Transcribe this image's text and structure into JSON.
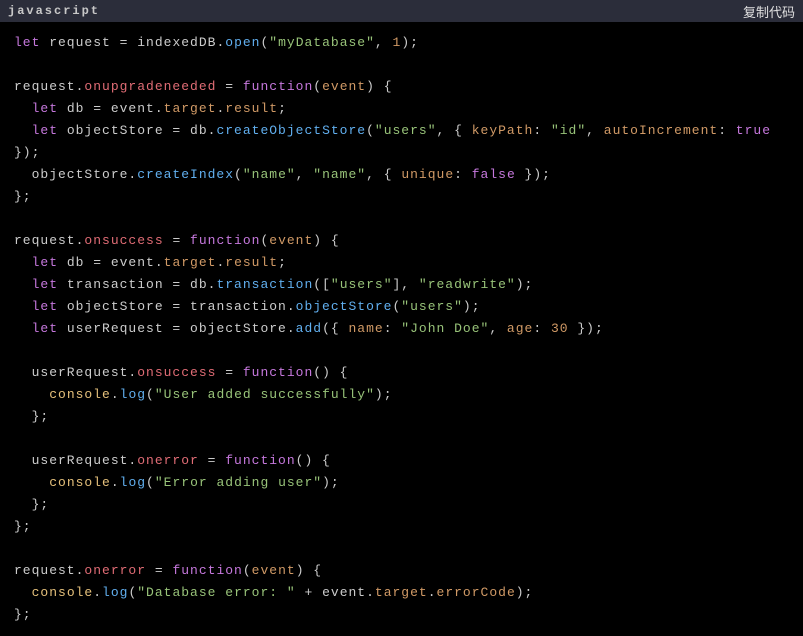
{
  "header": {
    "language": "javascript",
    "copy_label": "复制代码"
  },
  "code": {
    "tokens": [
      [
        [
          "kw",
          "let"
        ],
        [
          "punc",
          " request "
        ],
        [
          "punc",
          "="
        ],
        [
          "punc",
          " indexedDB"
        ],
        [
          "punc",
          "."
        ],
        [
          "method",
          "open"
        ],
        [
          "punc",
          "("
        ],
        [
          "str",
          "\"myDatabase\""
        ],
        [
          "punc",
          ", "
        ],
        [
          "num",
          "1"
        ],
        [
          "punc",
          ");"
        ]
      ],
      [],
      [
        [
          "punc",
          "request."
        ],
        [
          "prop",
          "onupgradeneeded"
        ],
        [
          "punc",
          " = "
        ],
        [
          "kw",
          "function"
        ],
        [
          "punc",
          "("
        ],
        [
          "prop2",
          "event"
        ],
        [
          "punc",
          ") {"
        ]
      ],
      [
        [
          "punc",
          "  "
        ],
        [
          "kw",
          "let"
        ],
        [
          "punc",
          " db = event."
        ],
        [
          "prop2",
          "target"
        ],
        [
          "punc",
          "."
        ],
        [
          "prop2",
          "result"
        ],
        [
          "punc",
          ";"
        ]
      ],
      [
        [
          "punc",
          "  "
        ],
        [
          "kw",
          "let"
        ],
        [
          "punc",
          " objectStore = db."
        ],
        [
          "method",
          "createObjectStore"
        ],
        [
          "punc",
          "("
        ],
        [
          "str",
          "\"users\""
        ],
        [
          "punc",
          ", { "
        ],
        [
          "objkey",
          "keyPath"
        ],
        [
          "punc",
          ": "
        ],
        [
          "str",
          "\"id\""
        ],
        [
          "punc",
          ", "
        ],
        [
          "objkey",
          "autoIncrement"
        ],
        [
          "punc",
          ": "
        ],
        [
          "kw",
          "true"
        ]
      ],
      [
        [
          "punc",
          "});"
        ]
      ],
      [
        [
          "punc",
          "  objectStore."
        ],
        [
          "method",
          "createIndex"
        ],
        [
          "punc",
          "("
        ],
        [
          "str",
          "\"name\""
        ],
        [
          "punc",
          ", "
        ],
        [
          "str",
          "\"name\""
        ],
        [
          "punc",
          ", { "
        ],
        [
          "objkey",
          "unique"
        ],
        [
          "punc",
          ": "
        ],
        [
          "kw",
          "false"
        ],
        [
          "punc",
          " });"
        ]
      ],
      [
        [
          "punc",
          "};"
        ]
      ],
      [],
      [
        [
          "punc",
          "request."
        ],
        [
          "prop",
          "onsuccess"
        ],
        [
          "punc",
          " = "
        ],
        [
          "kw",
          "function"
        ],
        [
          "punc",
          "("
        ],
        [
          "prop2",
          "event"
        ],
        [
          "punc",
          ") {"
        ]
      ],
      [
        [
          "punc",
          "  "
        ],
        [
          "kw",
          "let"
        ],
        [
          "punc",
          " db = event."
        ],
        [
          "prop2",
          "target"
        ],
        [
          "punc",
          "."
        ],
        [
          "prop2",
          "result"
        ],
        [
          "punc",
          ";"
        ]
      ],
      [
        [
          "punc",
          "  "
        ],
        [
          "kw",
          "let"
        ],
        [
          "punc",
          " transaction = db."
        ],
        [
          "method",
          "transaction"
        ],
        [
          "punc",
          "(["
        ],
        [
          "str",
          "\"users\""
        ],
        [
          "punc",
          "], "
        ],
        [
          "str",
          "\"readwrite\""
        ],
        [
          "punc",
          ");"
        ]
      ],
      [
        [
          "punc",
          "  "
        ],
        [
          "kw",
          "let"
        ],
        [
          "punc",
          " objectStore = transaction."
        ],
        [
          "method",
          "objectStore"
        ],
        [
          "punc",
          "("
        ],
        [
          "str",
          "\"users\""
        ],
        [
          "punc",
          ");"
        ]
      ],
      [
        [
          "punc",
          "  "
        ],
        [
          "kw",
          "let"
        ],
        [
          "punc",
          " userRequest = objectStore."
        ],
        [
          "method",
          "add"
        ],
        [
          "punc",
          "({ "
        ],
        [
          "objkey",
          "name"
        ],
        [
          "punc",
          ": "
        ],
        [
          "str",
          "\"John Doe\""
        ],
        [
          "punc",
          ", "
        ],
        [
          "objkey",
          "age"
        ],
        [
          "punc",
          ": "
        ],
        [
          "num",
          "30"
        ],
        [
          "punc",
          " });"
        ]
      ],
      [],
      [
        [
          "punc",
          "  userRequest."
        ],
        [
          "prop",
          "onsuccess"
        ],
        [
          "punc",
          " = "
        ],
        [
          "kw",
          "function"
        ],
        [
          "punc",
          "() {"
        ]
      ],
      [
        [
          "punc",
          "    "
        ],
        [
          "obj",
          "console"
        ],
        [
          "punc",
          "."
        ],
        [
          "method",
          "log"
        ],
        [
          "punc",
          "("
        ],
        [
          "str",
          "\"User added successfully\""
        ],
        [
          "punc",
          ");"
        ]
      ],
      [
        [
          "punc",
          "  };"
        ]
      ],
      [],
      [
        [
          "punc",
          "  userRequest."
        ],
        [
          "prop",
          "onerror"
        ],
        [
          "punc",
          " = "
        ],
        [
          "kw",
          "function"
        ],
        [
          "punc",
          "() {"
        ]
      ],
      [
        [
          "punc",
          "    "
        ],
        [
          "obj",
          "console"
        ],
        [
          "punc",
          "."
        ],
        [
          "method",
          "log"
        ],
        [
          "punc",
          "("
        ],
        [
          "str",
          "\"Error adding user\""
        ],
        [
          "punc",
          ");"
        ]
      ],
      [
        [
          "punc",
          "  };"
        ]
      ],
      [
        [
          "punc",
          "};"
        ]
      ],
      [],
      [
        [
          "punc",
          "request."
        ],
        [
          "prop",
          "onerror"
        ],
        [
          "punc",
          " = "
        ],
        [
          "kw",
          "function"
        ],
        [
          "punc",
          "("
        ],
        [
          "prop2",
          "event"
        ],
        [
          "punc",
          ") {"
        ]
      ],
      [
        [
          "punc",
          "  "
        ],
        [
          "obj",
          "console"
        ],
        [
          "punc",
          "."
        ],
        [
          "method",
          "log"
        ],
        [
          "punc",
          "("
        ],
        [
          "str",
          "\"Database error: \""
        ],
        [
          "punc",
          " + event."
        ],
        [
          "prop2",
          "target"
        ],
        [
          "punc",
          "."
        ],
        [
          "prop2",
          "errorCode"
        ],
        [
          "punc",
          ");"
        ]
      ],
      [
        [
          "punc",
          "};"
        ]
      ]
    ]
  }
}
